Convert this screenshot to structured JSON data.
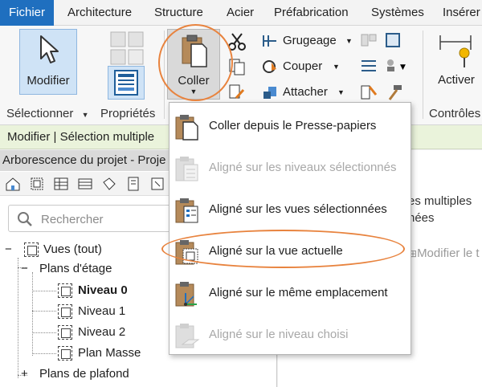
{
  "menubar": {
    "tabs": [
      "Fichier",
      "Architecture",
      "Structure",
      "Acier",
      "Préfabrication",
      "Systèmes",
      "Insérer"
    ]
  },
  "ribbon": {
    "modifier_label": "Modifier",
    "coller_label": "Coller",
    "activer_label": "Activer",
    "grugeage_label": "Grugeage",
    "couper_label": "Couper",
    "attacher_label": "Attacher",
    "panel_selectionner": "Sélectionner",
    "panel_proprietes": "Propriétés",
    "panel_controles": "Contrôles",
    "accent_color": "#1f6fbf"
  },
  "statusbar": {
    "text": "Modifier | Sélection multiple"
  },
  "browser": {
    "title": "Arborescence du projet - Proje",
    "search_placeholder": "Rechercher",
    "tree": {
      "root": "Vues (tout)",
      "floor_plans": "Plans d'étage",
      "levels": [
        "Niveau 0",
        "Niveau 1",
        "Niveau 2",
        "Plan Masse"
      ],
      "ceiling_plans": "Plans de plafond",
      "collapse_symbol": "−",
      "expand_symbol": "+"
    }
  },
  "right_panel": {
    "line1": "es multiples",
    "line2": "nées",
    "line3": "Modifier le t"
  },
  "dropdown": {
    "items": [
      {
        "label": "Coller depuis le Presse-papiers",
        "enabled": true
      },
      {
        "label": "Aligné sur les niveaux sélectionnés",
        "enabled": false
      },
      {
        "label": "Aligné sur les vues sélectionnées",
        "enabled": true
      },
      {
        "label": "Aligné sur la vue actuelle",
        "enabled": true
      },
      {
        "label": "Aligné sur le même emplacement",
        "enabled": true
      },
      {
        "label": "Aligné sur le niveau choisi",
        "enabled": false
      }
    ]
  },
  "highlight_color": "#e8833e"
}
